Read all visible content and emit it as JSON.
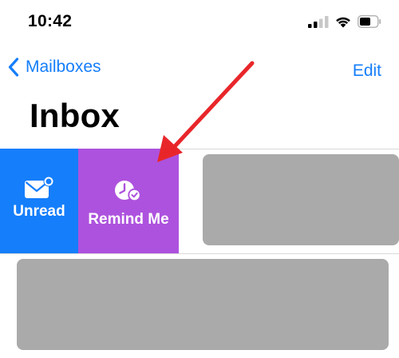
{
  "status_bar": {
    "time": "10:42",
    "icons": [
      "cellular-signal-icon",
      "wifi-icon",
      "battery-icon"
    ]
  },
  "nav": {
    "back_label": "Mailboxes",
    "edit_label": "Edit"
  },
  "inbox": {
    "title": "Inbox"
  },
  "swipe_actions": [
    {
      "label": "Unread",
      "icon": "envelope-badge-icon",
      "color": "#157EFB"
    },
    {
      "label": "Remind Me",
      "icon": "clock-check-icon",
      "color": "#AD52DE"
    }
  ],
  "colors": {
    "accent": "#157EFB",
    "remind": "#AD52DE",
    "annotation_arrow": "#E8262A",
    "placeholder": "#AAAAAA"
  }
}
